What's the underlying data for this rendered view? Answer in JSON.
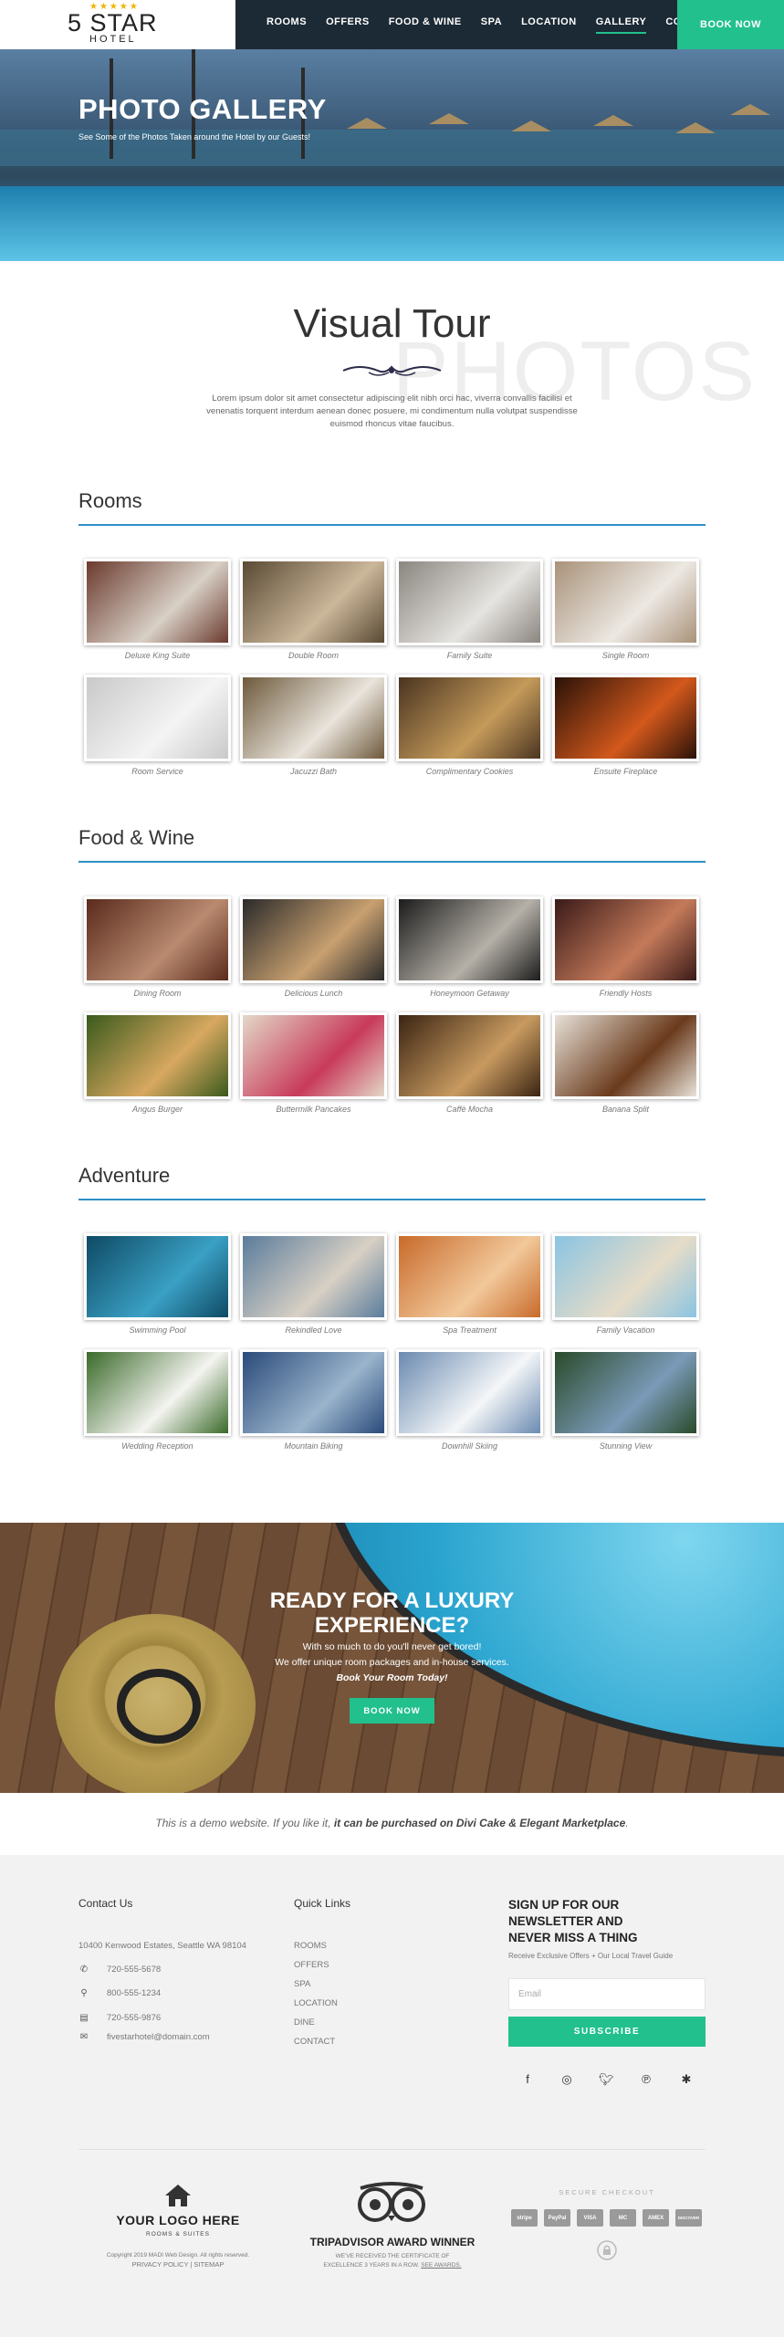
{
  "colors": {
    "accent": "#22c08c",
    "nav_bg": "#1c2a35",
    "rule_blue": "#2e8fc6"
  },
  "header": {
    "logo_stars": "★★★★★",
    "logo_name": "5 STAR",
    "logo_sub": "HOTEL",
    "nav": [
      "ROOMS",
      "OFFERS",
      "FOOD & WINE",
      "SPA",
      "LOCATION",
      "GALLERY",
      "CONTACT"
    ],
    "active_nav": "GALLERY",
    "book_label": "BOOK NOW"
  },
  "hero": {
    "title": "PHOTO GALLERY",
    "subtitle": "See Some of the Photos Taken around the Hotel by our Guests!"
  },
  "tour": {
    "bg_word": "PHOTOS",
    "title": "Visual Tour",
    "text": "Lorem ipsum dolor sit amet consectetur adipiscing elit nibh orci hac, viverra convallis facilisi et venenatis torquent interdum aenean donec posuere, mi condimentum nulla volutpat suspendisse euismod rhoncus vitae faucibus."
  },
  "sections": [
    {
      "title": "Rooms",
      "items": [
        {
          "caption": "Deluxe King Suite",
          "c1": "#6b3a2e",
          "c2": "#d8d0c6"
        },
        {
          "caption": "Double Room",
          "c1": "#5a4a34",
          "c2": "#cbb79a"
        },
        {
          "caption": "Family Suite",
          "c1": "#8a8680",
          "c2": "#e6e4e0"
        },
        {
          "caption": "Single Room",
          "c1": "#a9927a",
          "c2": "#ece8e2"
        },
        {
          "caption": "Room Service",
          "c1": "#c9c9c9",
          "c2": "#f4f4f4"
        },
        {
          "caption": "Jacuzzi Bath",
          "c1": "#6e5a3c",
          "c2": "#e9e4dc"
        },
        {
          "caption": "Complimentary Cookies",
          "c1": "#4a3420",
          "c2": "#c49a5a"
        },
        {
          "caption": "Ensuite Fireplace",
          "c1": "#2a1208",
          "c2": "#d2581c"
        }
      ]
    },
    {
      "title": "Food & Wine",
      "items": [
        {
          "caption": "Dining Room",
          "c1": "#5a2a1c",
          "c2": "#b98a70"
        },
        {
          "caption": "Delicious Lunch",
          "c1": "#2a2a2a",
          "c2": "#c8a070"
        },
        {
          "caption": "Honeymoon Getaway",
          "c1": "#1c1c1c",
          "c2": "#b5b0a8"
        },
        {
          "caption": "Friendly Hosts",
          "c1": "#3a1a18",
          "c2": "#c47a5a"
        },
        {
          "caption": "Angus Burger",
          "c1": "#3a5a1c",
          "c2": "#d8a860"
        },
        {
          "caption": "Buttermilk Pancakes",
          "c1": "#e4d8c8",
          "c2": "#c83a5a"
        },
        {
          "caption": "Caffè Mocha",
          "c1": "#3a2412",
          "c2": "#c89a60"
        },
        {
          "caption": "Banana Split",
          "c1": "#e8e2d8",
          "c2": "#6a3a1c"
        }
      ]
    },
    {
      "title": "Adventure",
      "items": [
        {
          "caption": "Swimming Pool",
          "c1": "#0e4a64",
          "c2": "#3aa0c4"
        },
        {
          "caption": "Rekindled Love",
          "c1": "#5a7c9c",
          "c2": "#d8d0c4"
        },
        {
          "caption": "Spa Treatment",
          "c1": "#c86a2a",
          "c2": "#f2c89a"
        },
        {
          "caption": "Family Vacation",
          "c1": "#8ac4e2",
          "c2": "#e6dcc8"
        },
        {
          "caption": "Wedding Reception",
          "c1": "#3a6a2a",
          "c2": "#f4f4f0"
        },
        {
          "caption": "Mountain Biking",
          "c1": "#2a4a7a",
          "c2": "#9ab4cc"
        },
        {
          "caption": "Downhill Skiing",
          "c1": "#6a8ab0",
          "c2": "#f4f6f8"
        },
        {
          "caption": "Stunning View",
          "c1": "#2a4a2a",
          "c2": "#7a9ab8"
        }
      ]
    }
  ],
  "luxury": {
    "title_line1": "READY FOR A LUXURY",
    "title_line2": "EXPERIENCE?",
    "line1": "With so much to do you'll never get bored!",
    "line2": "We offer unique room packages and in-house services.",
    "line3": "Book Your Room Today!",
    "button": "BOOK NOW"
  },
  "demo": {
    "prefix": "This is a demo website. If you like it, ",
    "bold": "it can be purchased on Divi Cake & Elegant Marketplace",
    "suffix": "."
  },
  "footer": {
    "contact_title": "Contact Us",
    "address": "10400 Kenwood Estates, Seattle WA 98104",
    "phone1": "720-555-5678",
    "phone2": "800-555-1234",
    "fax": "720-555-9876",
    "email": "fivestarhotel@domain.com",
    "links_title": "Quick Links",
    "links": [
      "ROOMS",
      "OFFERS",
      "SPA",
      "LOCATION",
      "DINE",
      "CONTACT"
    ],
    "news_line1": "SIGN UP FOR OUR",
    "news_line2": "NEWSLETTER AND",
    "news_line3": "NEVER MISS A THING",
    "news_sub": "Receive Exclusive Offers + Our Local Travel Guide",
    "email_placeholder": "Email",
    "subscribe": "SUBSCRIBE",
    "social": [
      "f",
      "◎",
      "🐦︎",
      "℗",
      "✱"
    ],
    "logo_title": "YOUR LOGO HERE",
    "logo_sub": "ROOMS & SUITES",
    "copyright": "Copyright 2019 MADI Web Design. All rights reserved.",
    "privacy": "PRIVACY POLICY | SITEMAP",
    "ta_title": "TRIPADVISOR AWARD WINNER",
    "ta_line1": "WE'VE RECEIVED THE CERTIFICATE OF",
    "ta_line2": "EXCELLENCE 3 YEARS IN A ROW.",
    "ta_link": "SEE AWARDS.",
    "secure": "SECURE CHECKOUT",
    "cards": [
      "stripe",
      "PayPal",
      "VISA",
      "MC",
      "AMEX",
      "DISCOVER"
    ]
  }
}
